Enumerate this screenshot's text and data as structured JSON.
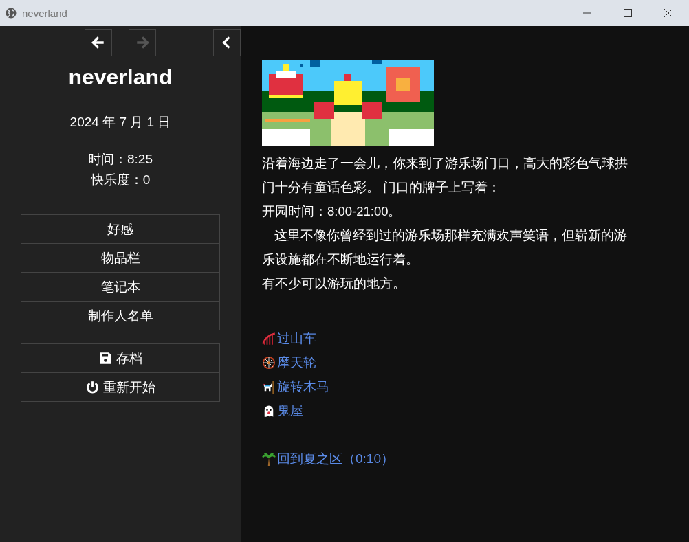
{
  "window": {
    "title": "neverland"
  },
  "sidebar": {
    "nav": [
      {
        "kind": "back",
        "disabled": false
      },
      {
        "kind": "forward",
        "disabled": true
      }
    ],
    "title": "neverland",
    "date": "2024 年 7 月 1 日",
    "stats": [
      "时间：8:25",
      "快乐度：0"
    ],
    "menu": [
      "好感",
      "物品栏",
      "笔记本",
      "制作人名单"
    ],
    "actions": [
      {
        "kind": "save",
        "label": "存档"
      },
      {
        "kind": "restart",
        "label": "重新开始"
      }
    ]
  },
  "story": {
    "paragraphs": [
      {
        "text": "沿着海边走了一会儿，你来到了游乐场门口，高大的彩色气球拱门十分有童话色彩。 门口的牌子上写着：",
        "indent": false
      },
      {
        "text": "开园时间：8:00-21:00。",
        "indent": false
      },
      {
        "text": "这里不像你曾经到过的游乐场那样充满欢声笑语，但崭新的游乐设施都在不断地运行着。",
        "indent": true
      },
      {
        "text": "有不少可以游玩的地方。",
        "indent": false
      }
    ],
    "links": [
      {
        "kind": "coaster",
        "label": "过山车"
      },
      {
        "kind": "wheel",
        "label": "摩天轮"
      },
      {
        "kind": "carousel",
        "label": "旋转木马"
      },
      {
        "kind": "ghost",
        "label": "鬼屋"
      }
    ],
    "exit": {
      "kind": "palm",
      "label": "回到夏之区（0:10）"
    }
  }
}
